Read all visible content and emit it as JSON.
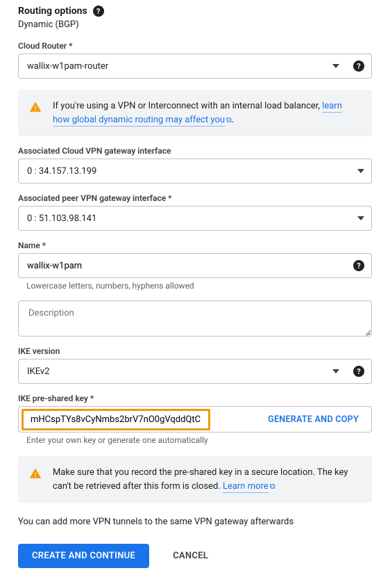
{
  "header": {
    "title": "Routing options",
    "routing_type": "Dynamic (BGP)"
  },
  "cloud_router": {
    "label": "Cloud Router *",
    "value": "wallix-w1pam-router"
  },
  "info1": {
    "text_a": "If you're using a VPN or Interconnect with an internal load balancer, ",
    "link": "learn how global dynamic routing may affect you"
  },
  "assoc_cloud": {
    "label": "Associated Cloud VPN gateway interface",
    "value": "0 : 34.157.13.199"
  },
  "assoc_peer": {
    "label": "Associated peer VPN gateway interface *",
    "value": "0 : 51.103.98.141"
  },
  "name": {
    "label": "Name *",
    "value": "wallix-w1pam",
    "helper": "Lowercase letters, numbers, hyphens allowed"
  },
  "description": {
    "placeholder": "Description"
  },
  "ike_version": {
    "label": "IKE version",
    "value": "IKEv2"
  },
  "psk": {
    "label": "IKE pre-shared key *",
    "value": "mHCspTYs8vCyNmbs2brV7nO0gVqddQtC",
    "generate_label": "GENERATE AND COPY",
    "helper": "Enter your own key or generate one automatically"
  },
  "info2": {
    "text": "Make sure that you record the pre-shared key in a secure location. The key can't be retrieved after this form is closed. ",
    "link": "Learn more"
  },
  "footer": {
    "text": "You can add more VPN tunnels to the same VPN gateway afterwards",
    "create": "CREATE AND CONTINUE",
    "cancel": "CANCEL"
  }
}
